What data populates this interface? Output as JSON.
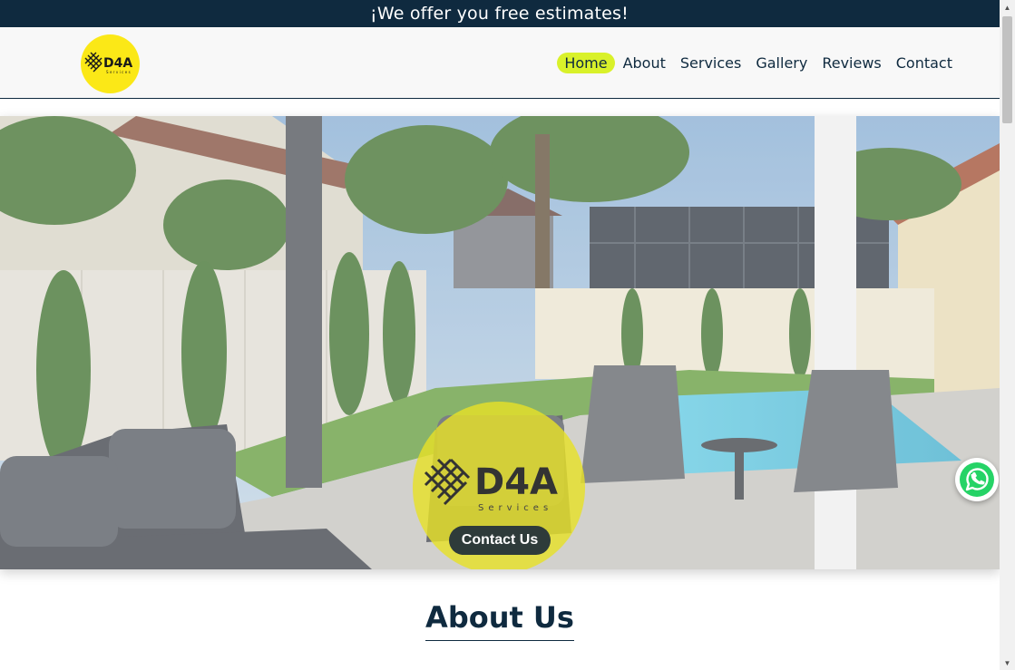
{
  "topbar": {
    "text": "¡We offer you free estimates!"
  },
  "header": {
    "logo": {
      "text": "D4A",
      "subtext": "Services",
      "icon": "d4a-weave-logo"
    },
    "nav": [
      {
        "label": "Home",
        "active": true
      },
      {
        "label": "About",
        "active": false
      },
      {
        "label": "Services",
        "active": false
      },
      {
        "label": "Gallery",
        "active": false
      },
      {
        "label": "Reviews",
        "active": false
      },
      {
        "label": "Contact",
        "active": false
      }
    ]
  },
  "hero": {
    "badge_logo": {
      "text": "D4A",
      "subtext": "Services"
    },
    "cta_label": "Contact Us",
    "colors": {
      "badge": "#e6e028",
      "cta": "#2e3b3a"
    }
  },
  "whatsapp": {
    "icon": "whatsapp-icon"
  },
  "about": {
    "title": "About Us"
  },
  "colors": {
    "navy": "#0f2a3f",
    "active_nav": "#d9f12a",
    "logo_bg": "#fbe817"
  }
}
